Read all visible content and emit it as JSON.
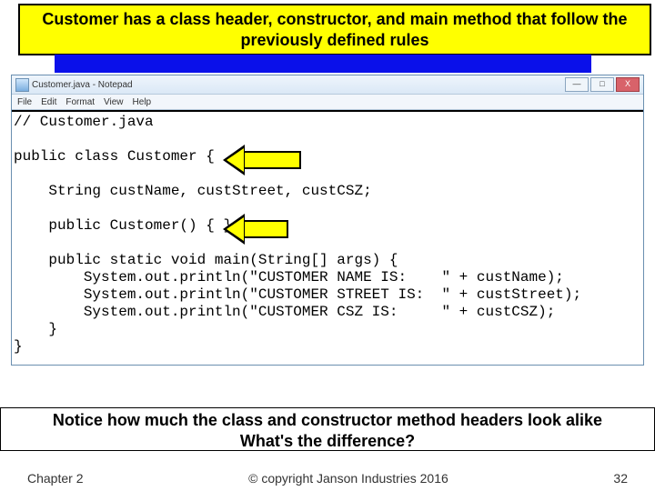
{
  "title": "Customer has a class header, constructor, and main method that follow the previously defined rules",
  "notepad": {
    "title": "Customer.java - Notepad",
    "menus": [
      "File",
      "Edit",
      "Format",
      "View",
      "Help"
    ],
    "min": "—",
    "max": "□",
    "close": "X"
  },
  "code": "// Customer.java\n\npublic class Customer {\n\n    String custName, custStreet, custCSZ;\n\n    public Customer() { }\n\n    public static void main(String[] args) {\n        System.out.println(\"CUSTOMER NAME IS:    \" + custName);\n        System.out.println(\"CUSTOMER STREET IS:  \" + custStreet);\n        System.out.println(\"CUSTOMER CSZ IS:     \" + custCSZ);\n    }\n}",
  "bottom": {
    "line1": "Notice how much the class and constructor method headers look alike",
    "line2": "What's the difference?"
  },
  "footer": {
    "left": "Chapter 2",
    "center": "© copyright Janson Industries 2016",
    "right": "32"
  }
}
